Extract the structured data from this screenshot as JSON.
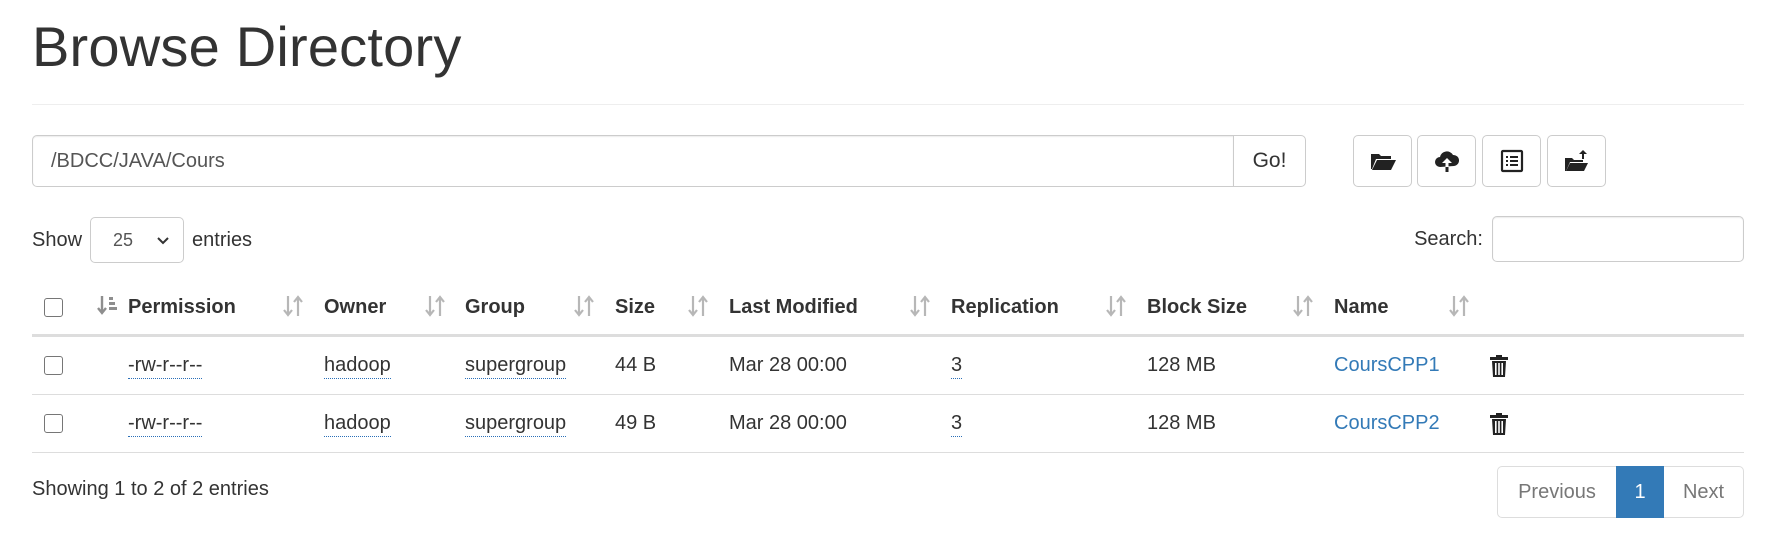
{
  "header": {
    "title": "Browse Directory"
  },
  "path_bar": {
    "value": "/BDCC/JAVA/Cours",
    "go_label": "Go!"
  },
  "toolbar": {
    "buttons": [
      {
        "icon": "folder-open-icon"
      },
      {
        "icon": "cloud-upload-icon"
      },
      {
        "icon": "list-alt-icon"
      },
      {
        "icon": "folder-move-icon"
      }
    ]
  },
  "length": {
    "show_label": "Show",
    "selected": "25",
    "entries_label": "entries"
  },
  "search": {
    "label": "Search:",
    "value": ""
  },
  "table": {
    "columns": [
      "Permission",
      "Owner",
      "Group",
      "Size",
      "Last Modified",
      "Replication",
      "Block Size",
      "Name"
    ],
    "rows": [
      {
        "permission": "-rw-r--r--",
        "owner": "hadoop",
        "group": "supergroup",
        "size": "44 B",
        "modified": "Mar 28 00:00",
        "replication": "3",
        "block_size": "128 MB",
        "name": "CoursCPP1"
      },
      {
        "permission": "-rw-r--r--",
        "owner": "hadoop",
        "group": "supergroup",
        "size": "49 B",
        "modified": "Mar 28 00:00",
        "replication": "3",
        "block_size": "128 MB",
        "name": "CoursCPP2"
      }
    ]
  },
  "footer": {
    "info": "Showing 1 to 2 of 2 entries",
    "pagination": {
      "previous": "Previous",
      "current": "1",
      "next": "Next"
    }
  },
  "colors": {
    "link": "#337ab7",
    "active_page": "#337ab7",
    "text": "#333333"
  }
}
